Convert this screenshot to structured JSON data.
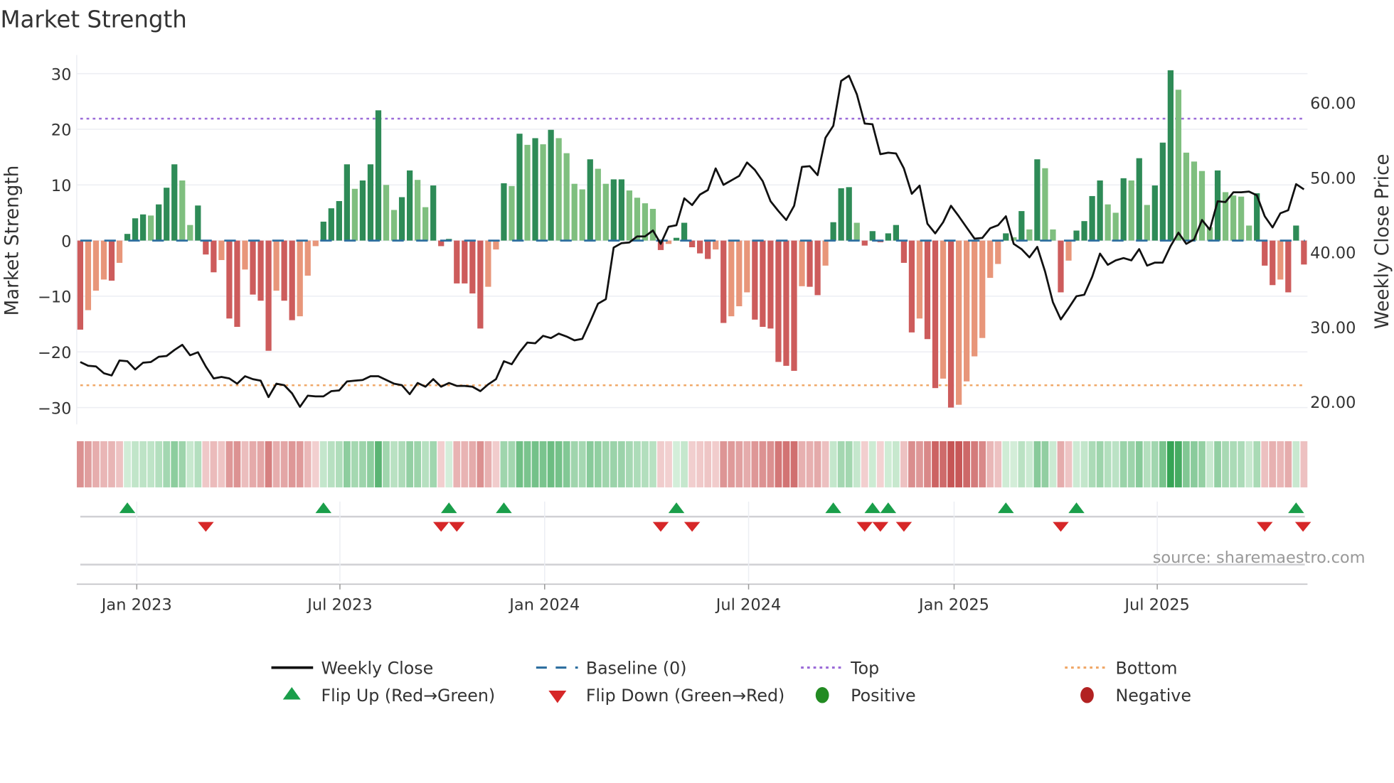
{
  "chart_data": {
    "type": "bar",
    "title": "Market Strength",
    "ylabel": "Market Strength",
    "y2label": "Weekly Close Price",
    "ylim": [
      -33,
      32
    ],
    "y2lim": [
      17.5,
      66.5
    ],
    "y_ticks": {
      "values": [
        30,
        20,
        10,
        0,
        -10,
        -20,
        -30
      ],
      "labels": [
        "30",
        "20",
        "10",
        "0",
        "−10",
        "−20",
        "−30"
      ]
    },
    "y2_ticks": {
      "values": [
        60,
        50,
        40,
        30,
        20
      ],
      "labels": [
        "60.00",
        "50.00",
        "40.00",
        "30.00",
        "20.00"
      ]
    },
    "x_ticks": [
      {
        "label": "Jan 2023",
        "week": 7.2
      },
      {
        "label": "Jul 2023",
        "week": 33.1
      },
      {
        "label": "Jan 2024",
        "week": 59.2
      },
      {
        "label": "Jul 2024",
        "week": 85.2
      },
      {
        "label": "Jan 2025",
        "week": 111.4
      },
      {
        "label": "Jul 2025",
        "week": 137.3
      }
    ],
    "top_level": 21.9,
    "bottom_level": -26,
    "baseline": 0,
    "strength": [
      -16,
      -12.5,
      -9,
      -7,
      -7.2,
      -4,
      1.2,
      4,
      4.7,
      4.5,
      6.5,
      9.5,
      13.7,
      10.8,
      2.8,
      6.3,
      -2.5,
      -5.7,
      -3.5,
      -14,
      -15.5,
      -5.2,
      -9.7,
      -10.8,
      -19.8,
      -9,
      -10.8,
      -14.3,
      -13.6,
      -6.3,
      -1,
      3.4,
      5.8,
      7.1,
      13.7,
      9.3,
      10.8,
      13.7,
      23.4,
      10,
      5.5,
      7.8,
      12.6,
      10.9,
      6,
      9.9,
      -1,
      0.3,
      -7.7,
      -7.7,
      -9.5,
      -15.8,
      -8.3,
      -1.6,
      10.3,
      9.8,
      19.2,
      17.2,
      18.4,
      17.3,
      19.9,
      18.4,
      15.7,
      10.2,
      9.2,
      14.6,
      12.9,
      10.2,
      11,
      11,
      9,
      7.7,
      6.7,
      5.7,
      -1.7,
      -0.6,
      0.5,
      3.2,
      -1.2,
      -2.3,
      -3.3,
      -1.6,
      -14.8,
      -13.6,
      -11.8,
      -9.3,
      -14.2,
      -15.5,
      -15.8,
      -21.8,
      -22.5,
      -23.4,
      -8.2,
      -8.3,
      -9.8,
      -4.5,
      3.3,
      9.4,
      9.6,
      3.2,
      -0.9,
      1.7,
      -0.3,
      1.3,
      2.8,
      -4,
      -16.5,
      -14,
      -17.7,
      -26.5,
      -24.8,
      -30,
      -29.5,
      -25.3,
      -20.8,
      -17.5,
      -6.7,
      -4.2,
      1.3,
      0.6,
      5.3,
      2,
      14.6,
      13,
      2,
      -9.3,
      -3.6,
      1.8,
      3.5,
      8,
      10.8,
      6.5,
      5,
      11.2,
      10.8,
      14.8,
      6.4,
      9.9,
      17.6,
      30.6,
      27.1,
      15.8,
      14.2,
      12.5,
      2.4,
      12.6,
      8.7,
      8.1,
      7.9,
      2.7,
      8.5,
      -4.5,
      -8,
      -7,
      -9.3,
      2.7,
      -4.3
    ],
    "weekly_close": [
      25.3,
      24.8,
      24.7,
      23.8,
      23.5,
      25.5,
      25.4,
      24.3,
      25.2,
      25.3,
      26,
      26.1,
      26.9,
      27.6,
      26.2,
      26.6,
      24.7,
      23.1,
      23.3,
      23.1,
      22.4,
      23.4,
      23,
      22.8,
      20.6,
      22.4,
      22.2,
      21.1,
      19.3,
      20.8,
      20.7,
      20.7,
      21.4,
      21.5,
      22.7,
      22.8,
      22.9,
      23.4,
      23.4,
      22.9,
      22.4,
      22.2,
      21,
      22.5,
      22,
      23,
      22,
      22.5,
      22.1,
      22.1,
      22,
      21.4,
      22.3,
      23,
      25.4,
      25,
      26.6,
      27.9,
      27.8,
      28.8,
      28.5,
      29.1,
      28.7,
      28.2,
      28.4,
      30.7,
      33.1,
      33.7,
      40.6,
      41.2,
      41.3,
      42.1,
      42.1,
      42.9,
      41.1,
      43.4,
      43.6,
      47.2,
      46.3,
      47.7,
      48.3,
      51.2,
      49,
      49.6,
      50.2,
      52,
      51,
      49.5,
      46.8,
      45.5,
      44.3,
      46.2,
      51.4,
      51.5,
      50.3,
      55.3,
      56.9,
      62.9,
      63.6,
      61.1,
      57.2,
      57.1,
      53.1,
      53.3,
      53.2,
      51.2,
      47.8,
      48.9,
      43.8,
      42.5,
      44,
      46.2,
      44.8,
      43.3,
      41.8,
      41.9,
      43.2,
      43.6,
      44.8,
      41.1,
      40.4,
      39.3,
      40.7,
      37.4,
      33.3,
      31,
      32.5,
      34.1,
      34.3,
      36.7,
      39.8,
      38.3,
      38.9,
      39.2,
      38.9,
      40.4,
      38.2,
      38.6,
      38.6,
      40.8,
      42.6,
      41.1,
      41.7,
      44.3,
      43,
      46.8,
      46.7,
      48,
      48,
      48.1,
      47.6,
      44.8,
      43.3,
      45.2,
      45.6,
      49.1,
      48.4
    ],
    "flip_up_weeks": [
      6,
      31,
      47,
      54,
      76,
      96,
      101,
      103,
      118,
      127,
      155
    ],
    "flip_down_weeks": [
      16,
      46,
      48,
      74,
      78,
      100,
      102,
      105,
      125,
      151,
      156
    ],
    "legend": {
      "placement": "bottom",
      "items": [
        "Weekly Close",
        "Baseline (0)",
        "Top",
        "Bottom",
        "Flip Up (Red→Green)",
        "Flip Down (Green→Red)",
        "Positive",
        "Negative"
      ]
    },
    "source": "source: sharemaestro.com",
    "colors": {
      "pos_strong": "#2e8b57",
      "pos_weak": "#7fbf7f",
      "neg_strong": "#cd5c5c",
      "neg_weak": "#e8967a",
      "top": "#9b6bd8",
      "bottom": "#f0a868",
      "baseline": "#2e6fa0",
      "flip_up": "#1a9e4a",
      "flip_down": "#d62728",
      "positive": "#228b22",
      "negative": "#b22222",
      "close": "#111111"
    }
  }
}
